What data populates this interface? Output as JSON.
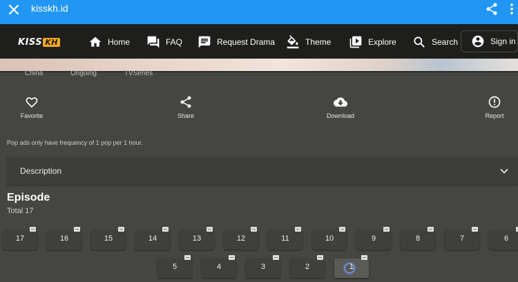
{
  "browser": {
    "url": "kisskh.id"
  },
  "header": {
    "logo_text": "KISS",
    "logo_badge": "KH",
    "nav": [
      {
        "label": "Home",
        "icon": "home-icon"
      },
      {
        "label": "FAQ",
        "icon": "faq-icon"
      },
      {
        "label": "Request Drama",
        "icon": "request-icon"
      },
      {
        "label": "Theme",
        "icon": "theme-icon"
      },
      {
        "label": "Explore",
        "icon": "explore-icon"
      },
      {
        "label": "Search",
        "icon": "search-icon"
      }
    ],
    "signin_label": "Sign in"
  },
  "tags": [
    "China",
    "Ongoing",
    "TVSeries"
  ],
  "actions": [
    {
      "label": "Favorite",
      "icon": "heart-icon"
    },
    {
      "label": "Share",
      "icon": "share-icon"
    },
    {
      "label": "Download",
      "icon": "download-icon"
    },
    {
      "label": "Report",
      "icon": "report-icon"
    }
  ],
  "notice": "Pop ads only have frequency of 1 pop per 1 hour.",
  "description": {
    "label": "Description"
  },
  "episodes": {
    "title": "Episode",
    "total": "Total 17",
    "row1": [
      "17",
      "16",
      "15",
      "14",
      "13",
      "12",
      "11",
      "10",
      "9",
      "8",
      "7",
      "6"
    ],
    "row2": [
      "5",
      "4",
      "3",
      "2",
      "1"
    ],
    "selected": "1"
  },
  "colors": {
    "browser_bar": "#2196f3",
    "header_bg": "#1e1e1c",
    "page_bg": "#454541",
    "logo_accent": "#f5a623"
  }
}
